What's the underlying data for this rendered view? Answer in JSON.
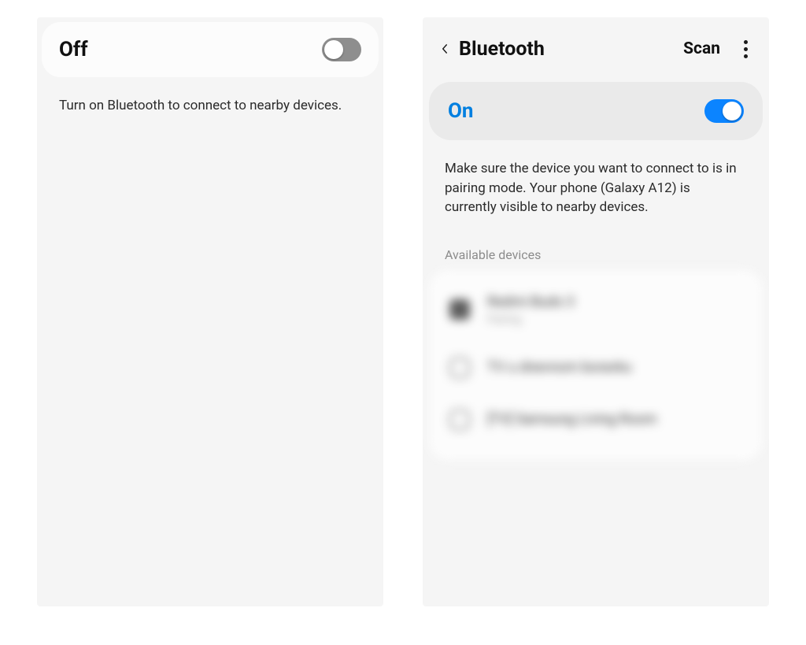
{
  "left_panel": {
    "toggle_label": "Off",
    "toggle_state": "off",
    "hint": "Turn on Bluetooth to connect to nearby devices."
  },
  "right_panel": {
    "title": "Bluetooth",
    "scan_label": "Scan",
    "toggle_label": "On",
    "toggle_state": "on",
    "hint": "Make sure the device you want to connect to is in pairing mode. Your phone (Galaxy A12) is currently visible to nearby devices.",
    "section_label": "Available devices",
    "devices": [
      {
        "name": "Redmi Buds 3",
        "sub": "Pairing",
        "icon": "headphones-icon"
      },
      {
        "name": "TV u dnevnom boravku",
        "sub": "",
        "icon": "tv-icon"
      },
      {
        "name": "[TV] Samsung Living Room",
        "sub": "",
        "icon": "tv-icon"
      }
    ]
  }
}
